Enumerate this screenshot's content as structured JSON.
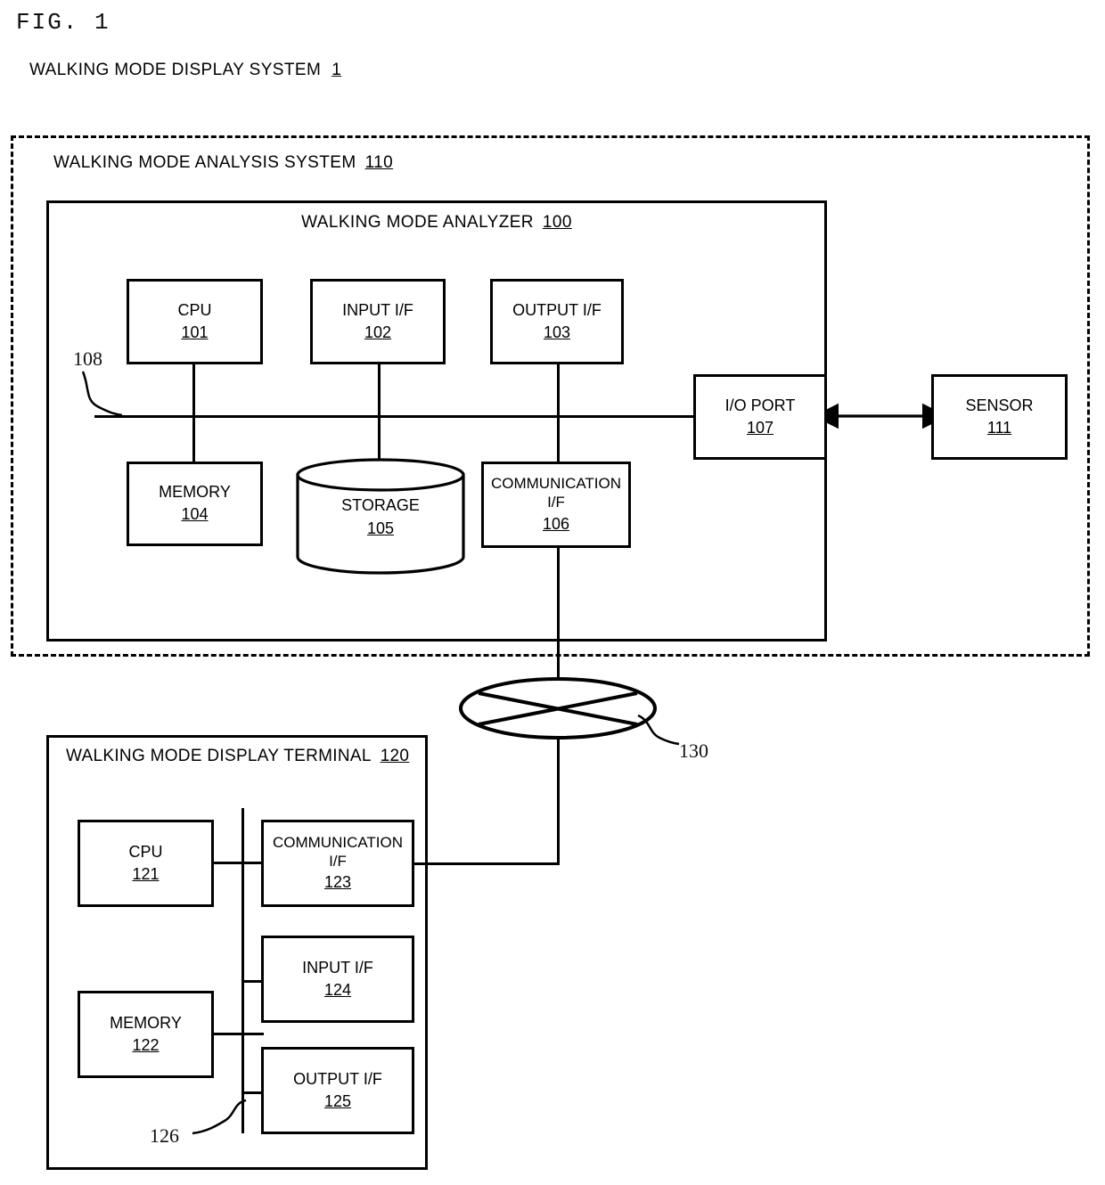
{
  "figure": {
    "label": "FIG. 1",
    "system_title": "WALKING MODE DISPLAY SYSTEM",
    "system_number": "1"
  },
  "analysis_system": {
    "title": "WALKING MODE ANALYSIS SYSTEM",
    "number": "110"
  },
  "analyzer": {
    "title": "WALKING MODE ANALYZER",
    "number": "100",
    "bus_ref": "108",
    "nodes": [
      {
        "label": "CPU",
        "number": "101"
      },
      {
        "label": "INPUT I/F",
        "number": "102"
      },
      {
        "label": "OUTPUT I/F",
        "number": "103"
      },
      {
        "label": "MEMORY",
        "number": "104"
      },
      {
        "label": "STORAGE",
        "number": "105"
      },
      {
        "label": "COMMUNICATION",
        "label2": "I/F",
        "number": "106"
      },
      {
        "label": "I/O PORT",
        "number": "107"
      }
    ]
  },
  "sensor": {
    "label": "SENSOR",
    "number": "111"
  },
  "network": {
    "ref": "130"
  },
  "terminal": {
    "title": "WALKING MODE DISPLAY TERMINAL",
    "number": "120",
    "bus_ref": "126",
    "nodes": [
      {
        "label": "CPU",
        "number": "121"
      },
      {
        "label": "MEMORY",
        "number": "122"
      },
      {
        "label": "COMMUNICATION",
        "label2": "I/F",
        "number": "123"
      },
      {
        "label": "INPUT I/F",
        "number": "124"
      },
      {
        "label": "OUTPUT I/F",
        "number": "125"
      }
    ]
  }
}
